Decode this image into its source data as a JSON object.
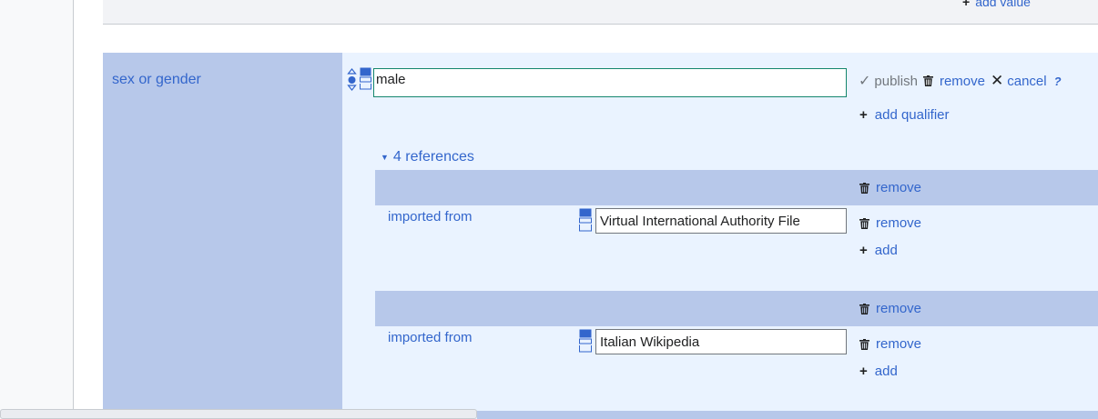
{
  "previous_statement": {
    "add_value_label": "add value"
  },
  "statement": {
    "property_label": "sex or gender",
    "value": "male",
    "toolbar": {
      "publish_label": "publish",
      "remove_label": "remove",
      "cancel_label": "cancel",
      "help_label": "?"
    },
    "add_qualifier_label": "add qualifier",
    "references_toggle_label": "4 references",
    "references": [
      {
        "remove_label": "remove",
        "property": "imported from",
        "value": "Virtual International Authority File",
        "snak_remove_label": "remove",
        "add_label": "add"
      },
      {
        "remove_label": "remove",
        "property": "imported from",
        "value": "Italian Wikipedia",
        "snak_remove_label": "remove",
        "add_label": "add"
      }
    ]
  },
  "colors": {
    "link": "#3366cc",
    "property_column": "#b7c8ea",
    "value_background": "#eaf3ff",
    "input_border_active": "#14866d"
  },
  "icons": [
    "rank-selector-icon",
    "snak-type-icon",
    "check-icon",
    "trash-icon",
    "close-icon",
    "plus-icon",
    "triangle-down-icon"
  ]
}
